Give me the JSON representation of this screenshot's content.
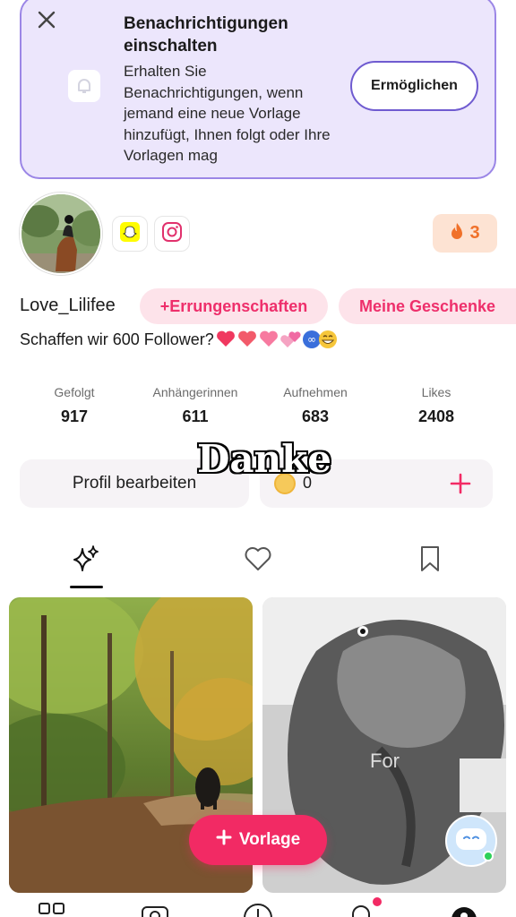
{
  "notification_banner": {
    "title": "Benachrichtigungen einschalten",
    "description": "Erhalten Sie Benachrichtigungen, wenn jemand eine neue Vorlage hinzufügt, Ihnen folgt oder Ihre Vorlagen mag",
    "enable_label": "Ermöglichen",
    "accent_color": "#9b86e6"
  },
  "profile": {
    "username": "Love_Lilifee",
    "streak_count": "3",
    "achievements_label": "+Errungenschaften",
    "gifts_label": "Meine Geschenke",
    "bio": "Schaffen wir 600 Follower?",
    "social_links": [
      "snapchat-icon",
      "instagram-icon"
    ]
  },
  "stats": [
    {
      "label": "Gefolgt",
      "value": "917"
    },
    {
      "label": "Anhängerinnen",
      "value": "611"
    },
    {
      "label": "Aufnehmen",
      "value": "683"
    },
    {
      "label": "Likes",
      "value": "2408"
    }
  ],
  "actions": {
    "edit_profile_label": "Profil bearbeiten",
    "coin_count": "0"
  },
  "video_overlay_text": "Danke",
  "tabs": [
    "sparkle-icon",
    "heart-icon",
    "bookmark-icon"
  ],
  "grid": {
    "card2_overlay": "For"
  },
  "fab": {
    "label": "Vorlage"
  },
  "colors": {
    "brand_pink": "#f22a64",
    "chip_bg": "#fde3ea",
    "streak_bg": "#fde3d3"
  }
}
